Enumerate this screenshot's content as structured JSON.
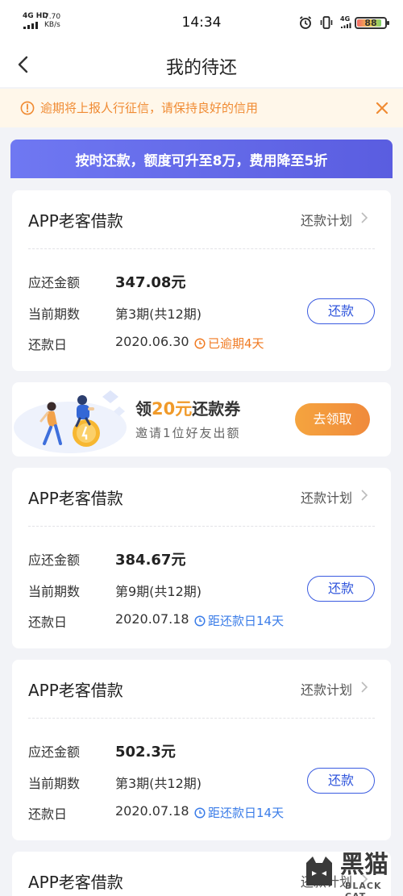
{
  "status_bar": {
    "network": "4G HD",
    "speed_value": "7.70",
    "speed_unit": "KB/s",
    "time": "14:34",
    "sim_label": "4G",
    "battery": "88"
  },
  "nav": {
    "title": "我的待还"
  },
  "notice": {
    "text": "逾期将上报人行征信，请保持良好的信用"
  },
  "promo": {
    "text": "按时还款，额度可升至8万，费用降至5折"
  },
  "labels": {
    "amount": "应还金额",
    "period": "当前期数",
    "due_date": "还款日",
    "plan": "还款计划",
    "repay": "还款"
  },
  "loans": [
    {
      "title": "APP老客借款",
      "amount": "347.08元",
      "period": "第3期(共12期)",
      "due_date": "2020.06.30",
      "status": "已逾期4天",
      "status_type": "overdue"
    },
    {
      "title": "APP老客借款",
      "amount": "384.67元",
      "period": "第9期(共12期)",
      "due_date": "2020.07.18",
      "status": "距还款日14天",
      "status_type": "due"
    },
    {
      "title": "APP老客借款",
      "amount": "502.3元",
      "period": "第3期(共12期)",
      "due_date": "2020.07.18",
      "status": "距还款日14天",
      "status_type": "due"
    },
    {
      "title": "APP老客借款"
    }
  ],
  "coupon": {
    "prefix": "领",
    "amount": "20元",
    "suffix": "还款券",
    "subtitle": "邀请1位好友出额",
    "button": "去领取"
  },
  "watermark": {
    "text": "黑猫",
    "sub": "BLACK CAT"
  },
  "colors": {
    "accent_blue": "#3a5be0",
    "overdue_orange": "#f07a22",
    "notice_orange": "#f08b33",
    "promo_gradient": [
      "#6f78f2",
      "#5a5de0"
    ],
    "claim_gradient": [
      "#f5a43e",
      "#f08a3c"
    ]
  },
  "icons": {
    "back": "chevron-left-icon",
    "notice": "warning-circle-icon",
    "close": "close-icon",
    "clock": "clock-icon",
    "plan": "chevron-right-icon"
  }
}
